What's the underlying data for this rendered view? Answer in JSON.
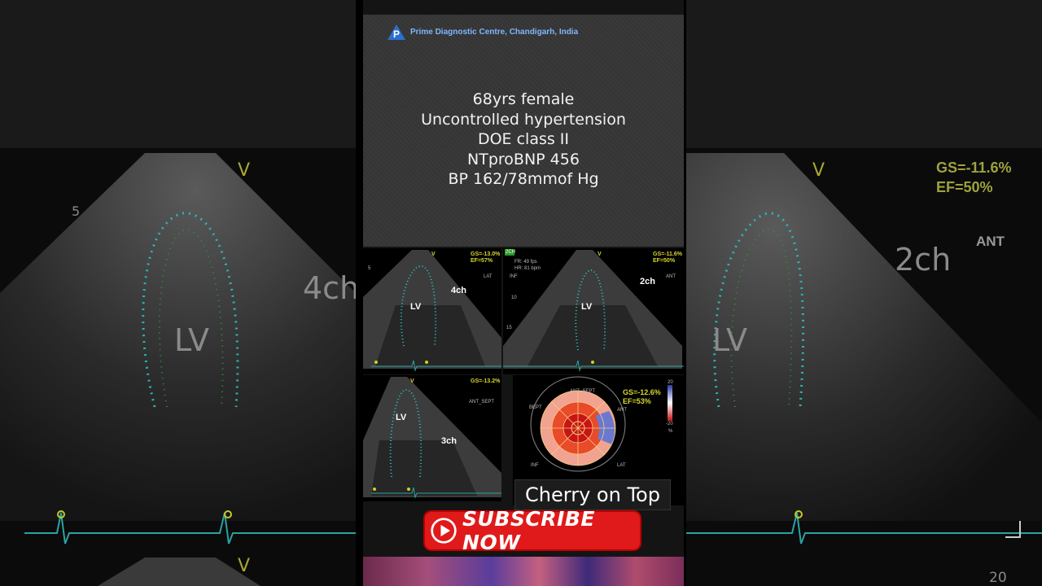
{
  "clinic": {
    "name": "Prime Diagnostic Centre, Chandigarh, India",
    "logo": "prime-logo-icon"
  },
  "patient": {
    "lines": [
      "68yrs female",
      "Uncontrolled hypertension",
      "DOE class II",
      "NTproBNP 456",
      "BP 162/78mmof Hg"
    ]
  },
  "views": {
    "four_ch": {
      "chamber": "LV",
      "view": "4ch",
      "gs": "GS=-13.0%",
      "ef": "EF=57%",
      "marker": "V",
      "side": "LAT",
      "depth": "5"
    },
    "two_ch": {
      "chamber": "LV",
      "view": "2ch",
      "gs": "GS=-11.6%",
      "ef": "EF=50%",
      "marker": "V",
      "side": "ANT",
      "inf": "INF",
      "badge": "2CH",
      "fr": "FR: 49 fps",
      "hr": "HR: 81 bpm",
      "d10": "10",
      "d15": "15"
    },
    "three_ch": {
      "chamber": "LV",
      "view": "3ch",
      "gs": "GS=-13.2%",
      "marker": "V",
      "side": "ANT_SEPT"
    }
  },
  "bullseye": {
    "gs": "GS=-12.6%",
    "ef": "EF=53%",
    "labels": {
      "top": "ANT_SEPT",
      "left_top": "BEPT",
      "right_top": "ANT",
      "left_bottom": "INF",
      "right_bottom": "LAT"
    },
    "scale": {
      "max": "20",
      "min": "-20",
      "unit": "%"
    },
    "colors": {
      "strong": "#c81414",
      "mid": "#e84a2a",
      "light": "#f4a090",
      "pos": "#6a78d0"
    }
  },
  "caption": "Cherry on Top",
  "subscribe": {
    "label": "SUBSCRIBE NOW",
    "icon": "play-icon",
    "color": "#e01a1a"
  },
  "background": {
    "left": {
      "view": "4ch",
      "chamber": "LV",
      "marker": "V",
      "depth": "5"
    },
    "right": {
      "view": "2ch",
      "chamber": "LV",
      "marker": "V",
      "side": "ANT",
      "gs": "GS=-11.6%",
      "ef": "EF=50%",
      "depth": "20"
    }
  }
}
